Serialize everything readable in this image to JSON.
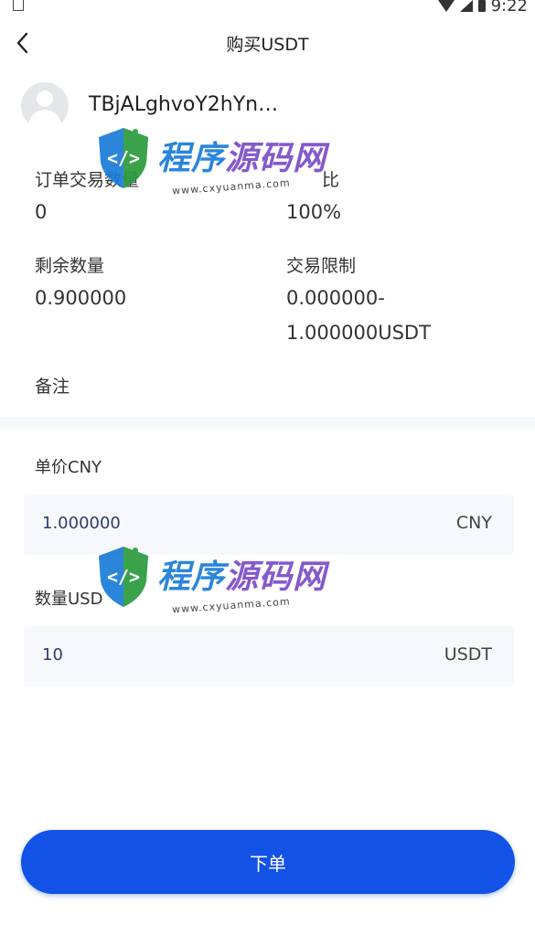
{
  "status_bar": {
    "time": "9:22"
  },
  "nav": {
    "title": "购买USDT"
  },
  "user": {
    "name": "TBjALghvoY2hYn…"
  },
  "info": {
    "order_qty_label": "订单交易数量",
    "order_qty_value": "0",
    "ratio_label": "比",
    "ratio_value": "100%",
    "remaining_label": "剩余数量",
    "remaining_value": "0.900000",
    "limit_label": "交易限制",
    "limit_value_line1": "0.000000-",
    "limit_value_line2": "1.000000USDT",
    "remark_label": "备注"
  },
  "form": {
    "price_label": "单价CNY",
    "price_value": "1.000000",
    "price_unit": "CNY",
    "qty_label": "数量USD",
    "qty_value": "10",
    "qty_unit": "USDT"
  },
  "actions": {
    "submit_label": "下单"
  },
  "watermark": {
    "text_part1": "程序",
    "text_part2": "源码网",
    "url": "www.cxyuanma.com"
  },
  "colors": {
    "primary": "#1352e6",
    "input_bg": "#f6f8fb"
  }
}
